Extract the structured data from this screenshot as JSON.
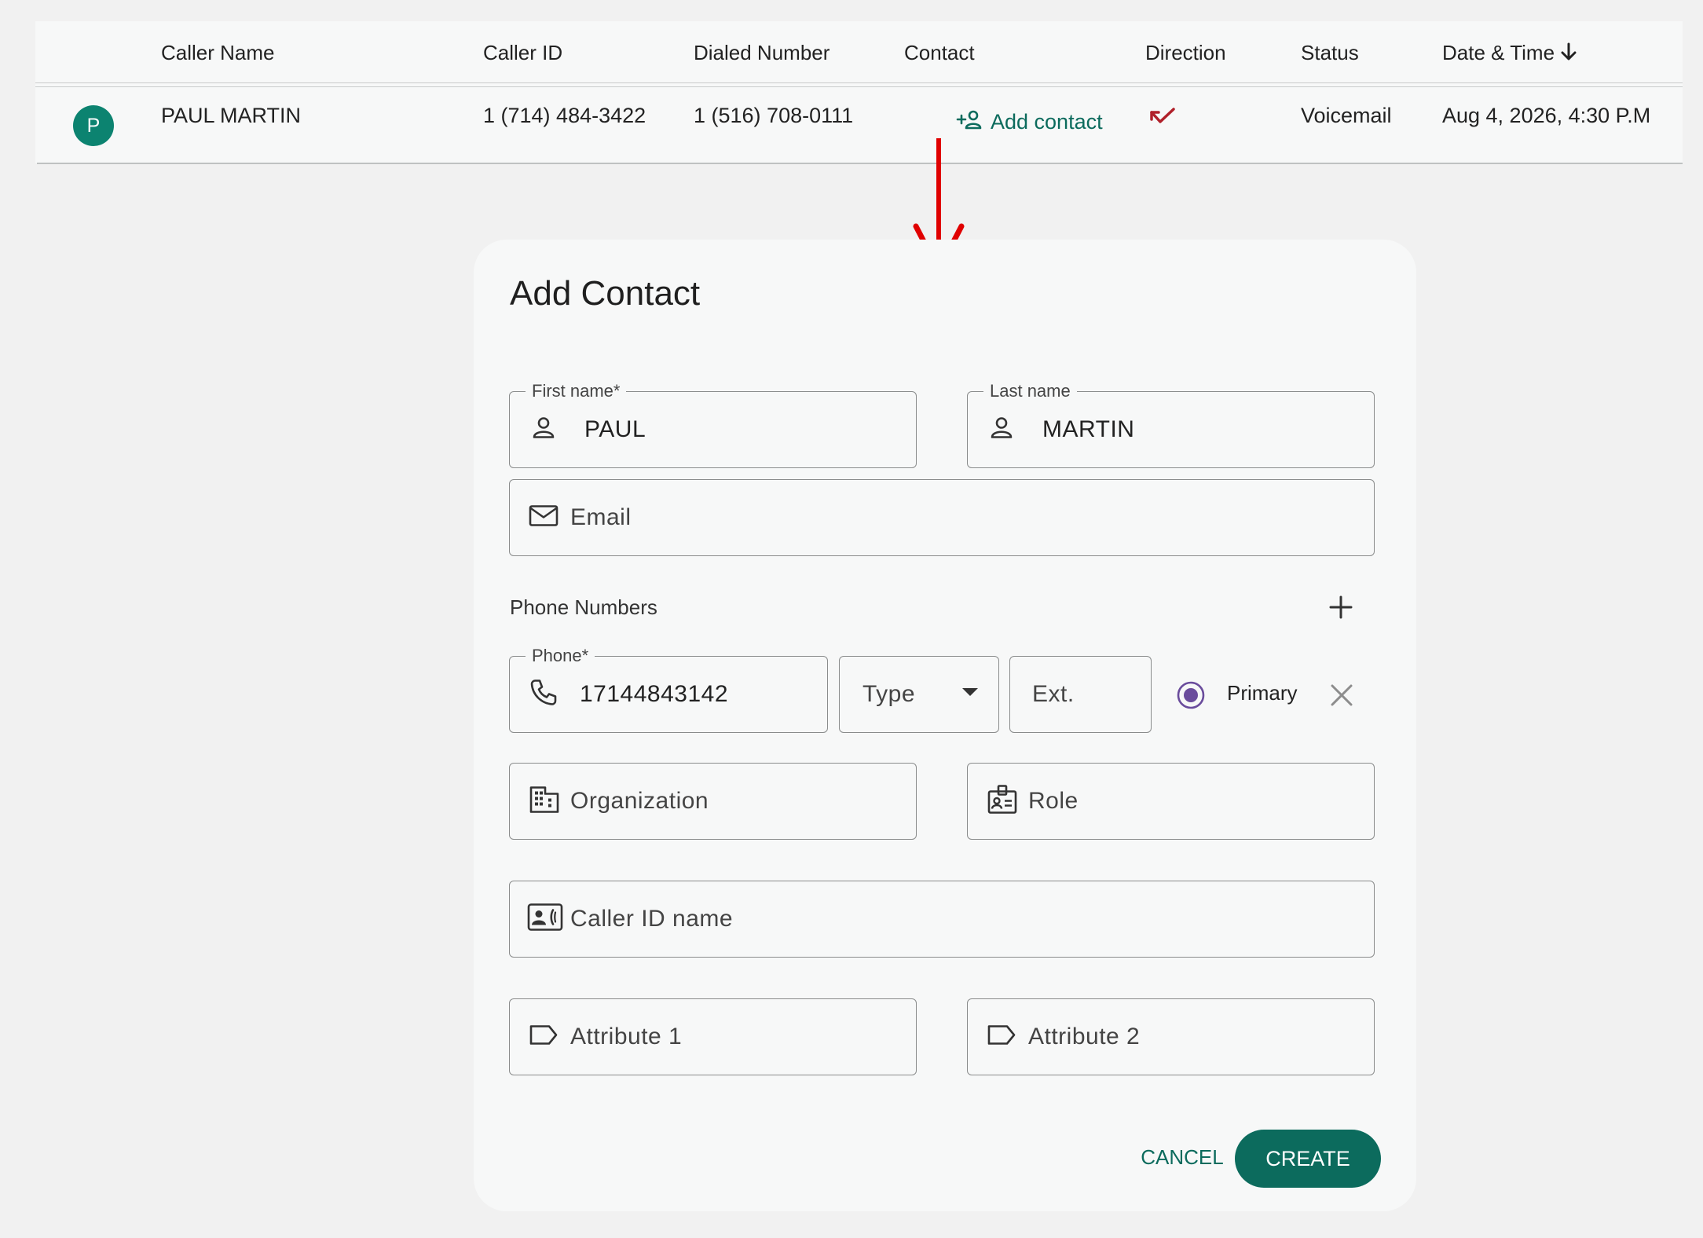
{
  "table": {
    "headers": {
      "caller_name": "Caller Name",
      "caller_id": "Caller ID",
      "dialed_number": "Dialed Number",
      "contact": "Contact",
      "direction": "Direction",
      "status": "Status",
      "date_time": "Date & Time"
    },
    "sort_icon": "arrow-down-icon",
    "row": {
      "avatar_letter": "P",
      "caller_name": "PAUL MARTIN",
      "caller_id": "1 (714) 484-3422",
      "dialed_number": "1 (516) 708-0111",
      "contact_action": "Add contact",
      "direction_icon": "call-missed-icon",
      "status": "Voicemail",
      "date_time": "Aug 4, 2026, 4:30 P.M"
    }
  },
  "dialog": {
    "title": "Add Contact",
    "first_name": {
      "label": "First name*",
      "value": "PAUL"
    },
    "last_name": {
      "label": "Last name",
      "value": "MARTIN"
    },
    "email": {
      "placeholder": "Email"
    },
    "phone_section": {
      "label": "Phone Numbers"
    },
    "phone": {
      "label": "Phone*",
      "value": "17144843142"
    },
    "type": {
      "placeholder": "Type"
    },
    "ext": {
      "placeholder": "Ext."
    },
    "primary": {
      "label": "Primary",
      "selected": true
    },
    "organization": {
      "placeholder": "Organization"
    },
    "role": {
      "placeholder": "Role"
    },
    "caller_id_name": {
      "placeholder": "Caller ID name"
    },
    "attribute1": {
      "placeholder": "Attribute 1"
    },
    "attribute2": {
      "placeholder": "Attribute 2"
    },
    "cancel_label": "CANCEL",
    "create_label": "CREATE"
  },
  "colors": {
    "accent": "#0c6b5d",
    "avatar": "#0c8370",
    "annotation_arrow": "#e00000",
    "missed_call": "#b0202a",
    "radio": "#6a4c9c"
  }
}
